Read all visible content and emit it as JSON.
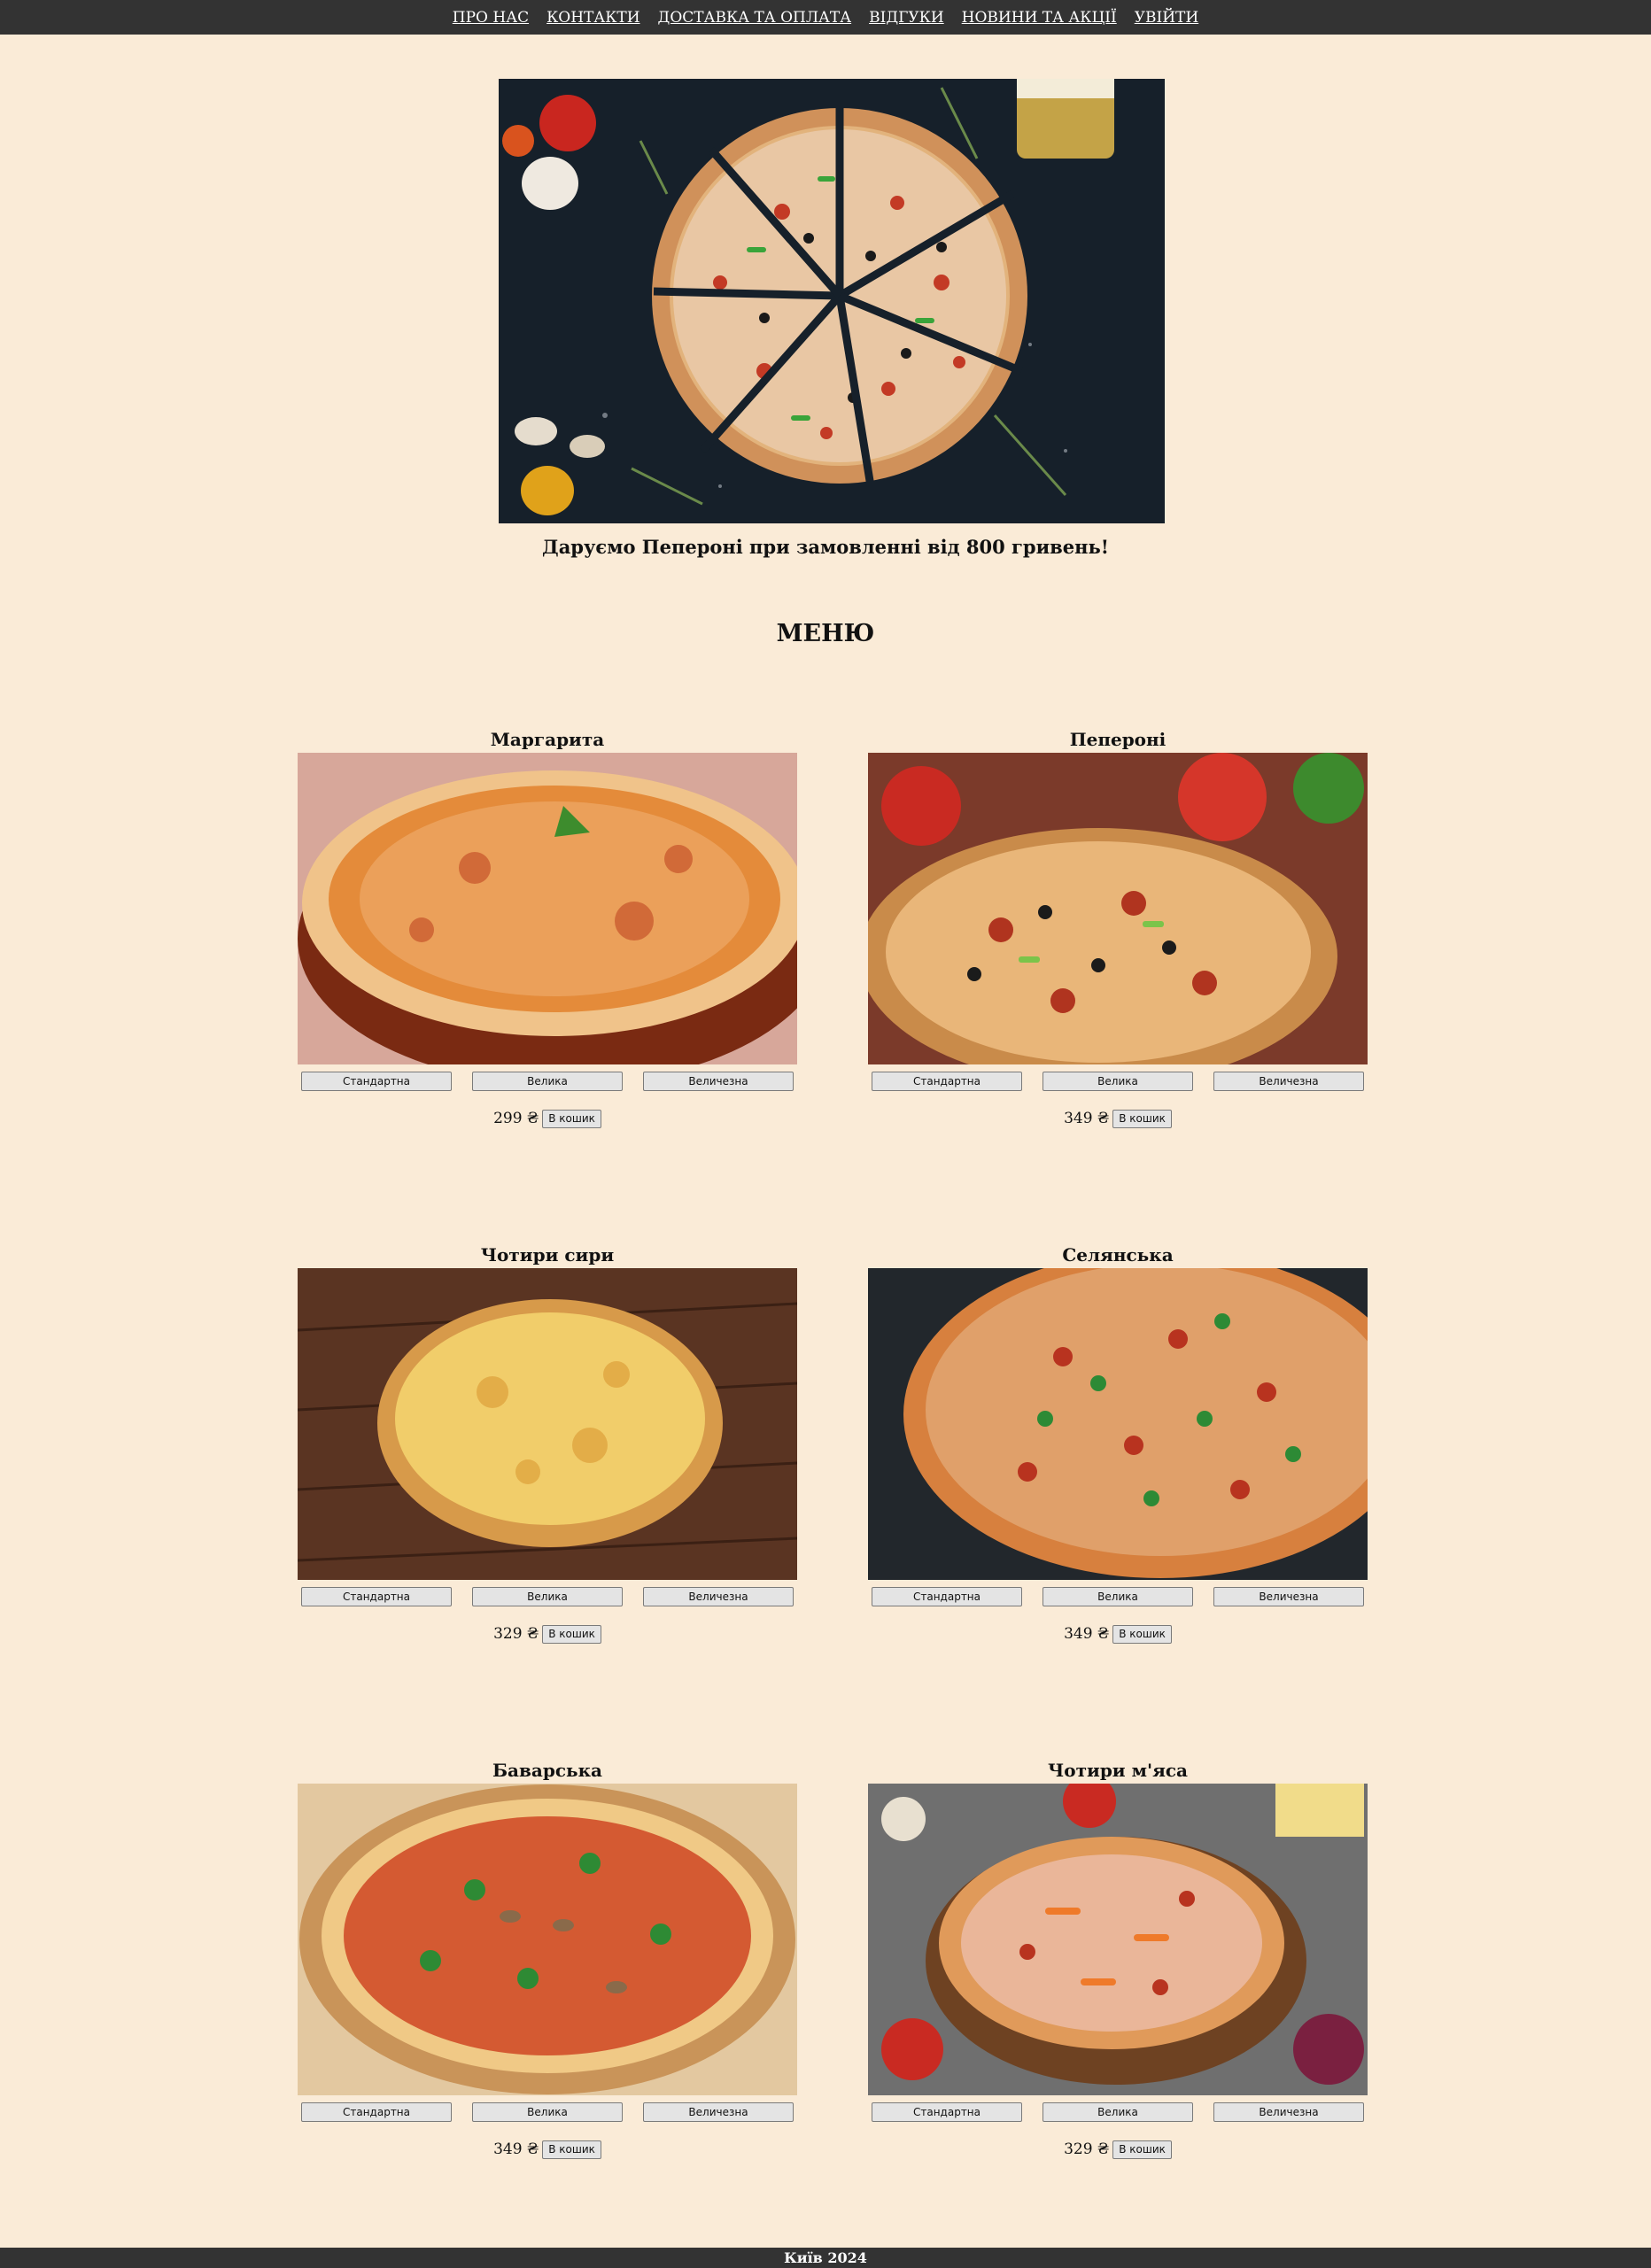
{
  "nav": {
    "items": [
      {
        "label": "ПРО НАС"
      },
      {
        "label": "КОНТАКТИ"
      },
      {
        "label": "ДОСТАВКА ТА ОПЛАТА"
      },
      {
        "label": "ВІДГУКИ"
      },
      {
        "label": "НОВИНИ ТА АКЦІЇ"
      },
      {
        "label": "УВІЙТИ"
      }
    ]
  },
  "hero": {
    "image": "sliced-pizza-dark-table-photo"
  },
  "promo": "Даруємо Пепероні при замовленні від 800 гривень!",
  "menu_title": "МЕНЮ",
  "size_labels": {
    "standard": "Стандартна",
    "large": "Велика",
    "huge": "Величезна"
  },
  "cart_label": "В кошик",
  "products": [
    {
      "name": "Маргарита",
      "price": "299 ₴",
      "image": "margherita-pizza-photo"
    },
    {
      "name": "Пепероні",
      "price": "349 ₴",
      "image": "pepperoni-pizza-photo"
    },
    {
      "name": "Чотири сири",
      "price": "329 ₴",
      "image": "four-cheese-pizza-photo"
    },
    {
      "name": "Селянська",
      "price": "349 ₴",
      "image": "country-pizza-photo"
    },
    {
      "name": "Баварська",
      "price": "349 ₴",
      "image": "bavarian-pizza-photo"
    },
    {
      "name": "Чотири м'яса",
      "price": "329 ₴",
      "image": "four-meats-pizza-photo"
    }
  ],
  "footer": "Київ 2024",
  "colors": {
    "background": "#faebd7",
    "nav_bar": "#333333",
    "nav_text": "#ffffff",
    "button": "#e4e4e4"
  }
}
